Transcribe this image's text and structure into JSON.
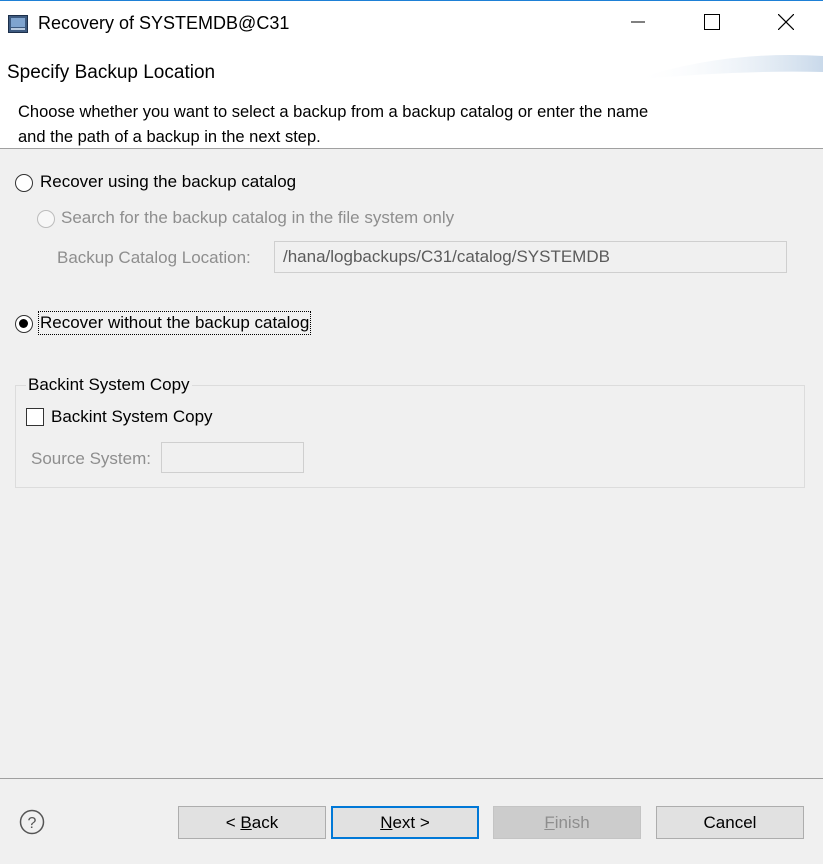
{
  "window": {
    "title": "Recovery of SYSTEMDB@C31",
    "controls": [
      "minimize-icon",
      "maximize-icon",
      "close-icon"
    ]
  },
  "header": {
    "title": "Specify Backup Location",
    "description": "Choose whether you want to select a backup from a backup catalog or enter the name and the path of a backup in the next step."
  },
  "options": {
    "use_catalog": {
      "label": "Recover using the backup catalog",
      "selected": false
    },
    "search_fs_only": {
      "label": "Search for the backup catalog in the file system only",
      "enabled": false
    },
    "catalog_location": {
      "label": "Backup Catalog Location:",
      "value": "/hana/logbackups/C31/catalog/SYSTEMDB"
    },
    "without_catalog": {
      "label": "Recover without the backup catalog",
      "selected": true
    }
  },
  "backint": {
    "group_title": "Backint System Copy",
    "checkbox_label": "Backint System Copy",
    "checked": false,
    "source_system_label": "Source System:",
    "source_system_value": ""
  },
  "buttons": {
    "back": {
      "prefix": "< ",
      "mnemonic": "B",
      "rest": "ack"
    },
    "next": {
      "mnemonic": "N",
      "rest": "ext >"
    },
    "finish": {
      "mnemonic": "F",
      "rest": "inish"
    },
    "cancel": "Cancel"
  },
  "icons": {
    "help": "help-icon",
    "app": "app-icon"
  },
  "colors": {
    "window_accent": "#1e80d6",
    "default_button_border": "#0078d7",
    "background": "#f0f0f0"
  }
}
